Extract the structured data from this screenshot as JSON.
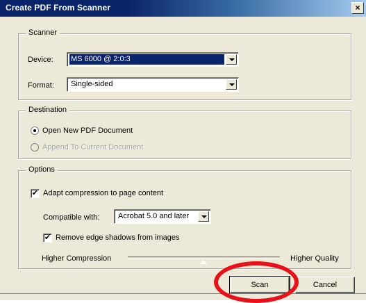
{
  "window": {
    "title": "Create PDF From Scanner",
    "close_glyph": "×"
  },
  "scanner": {
    "legend": "Scanner",
    "device_label": "Device:",
    "device_value": "MS 6000 @ 2:0:3",
    "format_label": "Format:",
    "format_value": "Single-sided"
  },
  "destination": {
    "legend": "Destination",
    "options": [
      {
        "label": "Open New PDF Document",
        "selected": true,
        "enabled": true
      },
      {
        "label": "Append To Current Document",
        "selected": false,
        "enabled": false
      }
    ]
  },
  "options": {
    "legend": "Options",
    "adapt_compression_label": "Adapt compression to page content",
    "adapt_compression_checked": true,
    "compatible_label": "Compatible with:",
    "compatible_value": "Acrobat 5.0 and later",
    "remove_shadows_label": "Remove edge shadows from images",
    "remove_shadows_checked": true,
    "slider_left_label": "Higher Compression",
    "slider_right_label": "Higher Quality",
    "slider_value": 0.5
  },
  "buttons": {
    "scan": "Scan",
    "cancel": "Cancel"
  },
  "annotation": {
    "highlight_color": "#e8111a",
    "target": "scan-button"
  },
  "colors": {
    "titlebar": "#0a246a",
    "dialog_bg": "#ece9d8",
    "selection": "#0a246a"
  }
}
